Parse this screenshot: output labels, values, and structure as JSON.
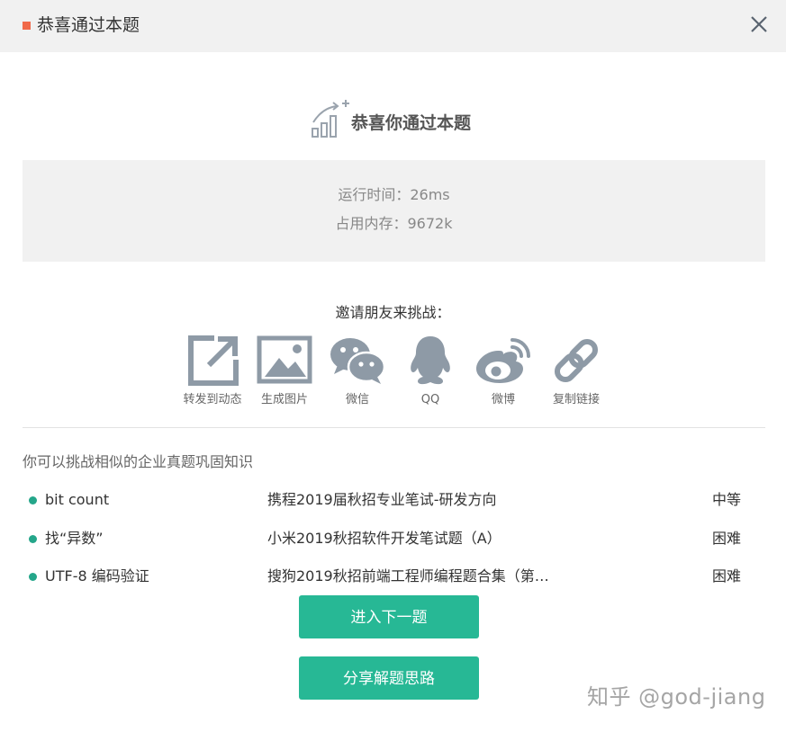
{
  "header": {
    "title": "恭喜通过本题",
    "close_icon": "close-icon",
    "marker_color": "#f0694a"
  },
  "result": {
    "headline": "恭喜你通过本题",
    "icon": "bar-chart-up-icon",
    "runtime": "运行时间：26ms",
    "memory": "占用内存：9672k"
  },
  "share": {
    "prompt": "邀请朋友来挑战：",
    "items": [
      {
        "label": "转发到动态",
        "icon": "share-out-icon"
      },
      {
        "label": "生成图片",
        "icon": "image-icon"
      },
      {
        "label": "微信",
        "icon": "wechat-icon"
      },
      {
        "label": "QQ",
        "icon": "qq-icon"
      },
      {
        "label": "微博",
        "icon": "weibo-icon"
      },
      {
        "label": "复制链接",
        "icon": "link-icon"
      }
    ]
  },
  "related": {
    "title": "你可以挑战相似的企业真题巩固知识",
    "problems": [
      {
        "name": "bit count",
        "source": "携程2019届秋招专业笔试-研发方向",
        "difficulty": "中等"
      },
      {
        "name": "找“异数”",
        "source": "小米2019秋招软件开发笔试题（A）",
        "difficulty": "困难"
      },
      {
        "name": "UTF-8 编码验证",
        "source": "搜狗2019秋招前端工程师编程题合集（第…",
        "difficulty": "困难"
      }
    ]
  },
  "buttons": {
    "next": "进入下一题",
    "share_solution": "分享解题思路"
  },
  "watermark": "知乎 @god-jiang",
  "colors": {
    "accent": "#27b895",
    "dot": "#24a68a",
    "icon_gray": "#8e9aa6"
  }
}
